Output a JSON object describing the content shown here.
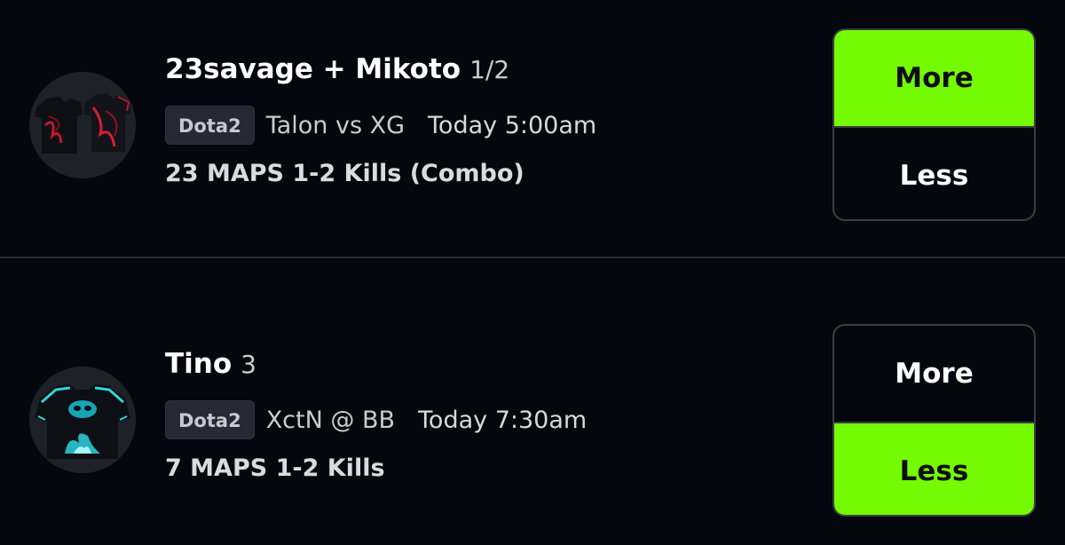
{
  "picks": [
    {
      "player_name": "23savage + Mikoto",
      "player_count": "1/2",
      "game": "Dota2",
      "matchup": "Talon vs XG",
      "start_time": "Today 5:00am",
      "stat_line": "23 MAPS 1-2 Kills (Combo)",
      "more_label": "More",
      "less_label": "Less",
      "selected": "More",
      "jersey_icon": "jersey-red-icon"
    },
    {
      "player_name": "Tino",
      "player_count": "3",
      "game": "Dota2",
      "matchup": "XctN @ BB",
      "start_time": "Today 7:30am",
      "stat_line": "7 MAPS 1-2 Kills",
      "more_label": "More",
      "less_label": "Less",
      "selected": "Less",
      "jersey_icon": "jersey-cyan-icon"
    }
  ],
  "colors": {
    "background": "#05070f",
    "accent_selected": "#74fa02",
    "divider": "#2a2d36"
  }
}
